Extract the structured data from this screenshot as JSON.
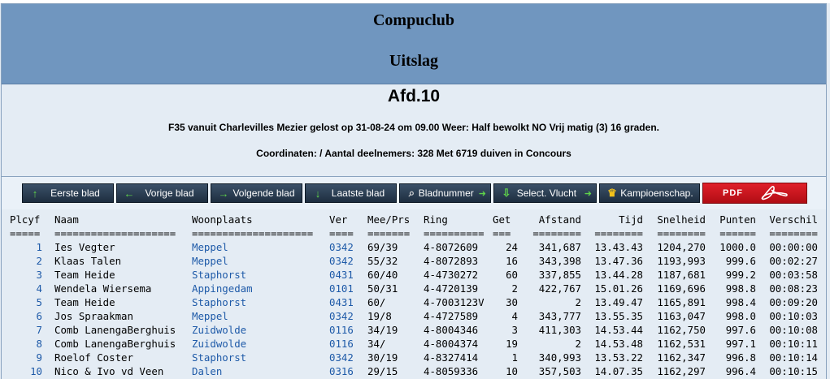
{
  "header": {
    "club": "Compuclub",
    "subtitle": "Uitslag"
  },
  "section": {
    "title": "Afd.10"
  },
  "flight_info": "F35 vanuit Charlevilles Mezier gelost op 31-08-24 om 09.00 Weer: Half bewolkt NO Vrij matig (3) 16 graden.",
  "coords_info": "Coordinaten: / Aantal deelnemers: 328 Met 6719 duiven in Concours",
  "nav": {
    "first": "Eerste blad",
    "prev": "Vorige blad",
    "next": "Volgende blad",
    "last": "Laatste blad",
    "page_number": "Bladnummer",
    "select_flight": "Select. Vlucht",
    "championship": "Kampioenschap.",
    "pdf": "PDF"
  },
  "colors": {
    "header_bg": "#7096bf",
    "page_bg": "#e4ecf4",
    "button_bg": "#2c3e52",
    "link_blue": "#1e5aa8",
    "pdf_red": "#d41820"
  },
  "icons": {
    "first": "up-arrow-icon",
    "prev": "left-arrow-icon",
    "next": "right-arrow-icon",
    "last": "down-arrow-icon",
    "page_number": "search-icon",
    "select_flight": "download-icon",
    "championship": "crown-icon",
    "pdf": "acrobat-icon"
  },
  "table": {
    "headers": [
      "Plcyf",
      "Naam",
      "Woonplaats",
      "Ver",
      "Mee/Prs",
      "Ring",
      "Get",
      "Afstand",
      "Tijd",
      "Snelheid",
      "Punten",
      "Verschil"
    ],
    "underlines": [
      "=====",
      "====================",
      "====================",
      "====",
      "=======",
      "==========",
      "===",
      "========",
      "========",
      "========",
      "======",
      "========"
    ],
    "rows": [
      [
        "1",
        "Ies Vegter",
        "Meppel",
        "0342",
        "69/39",
        "4-8072609",
        "24",
        "341,687",
        "13.43.43",
        "1204,270",
        "1000.0",
        "00:00:00"
      ],
      [
        "2",
        "Klaas Talen",
        "Meppel",
        "0342",
        "55/32",
        "4-8072893",
        "16",
        "343,398",
        "13.47.36",
        "1193,993",
        "999.6",
        "00:02:27"
      ],
      [
        "3",
        "Team Heide",
        "Staphorst",
        "0431",
        "60/40",
        "4-4730272",
        "60",
        "337,855",
        "13.44.28",
        "1187,681",
        "999.2",
        "00:03:58"
      ],
      [
        "4",
        "Wendela Wiersema",
        "Appingedam",
        "0101",
        "50/31",
        "4-4720139",
        "2",
        "422,767",
        "15.01.26",
        "1169,696",
        "998.8",
        "00:08:23"
      ],
      [
        "5",
        "Team Heide",
        "Staphorst",
        "0431",
        "60/",
        "4-7003123V",
        "30",
        "2",
        "13.49.47",
        "1165,891",
        "998.4",
        "00:09:20"
      ],
      [
        "6",
        "Jos Spraakman",
        "Meppel",
        "0342",
        "19/8",
        "4-4727589",
        "4",
        "343,777",
        "13.55.35",
        "1163,047",
        "998.0",
        "00:10:03"
      ],
      [
        "7",
        "Comb LanengaBerghuis",
        "Zuidwolde",
        "0116",
        "34/19",
        "4-8004346",
        "3",
        "411,303",
        "14.53.44",
        "1162,750",
        "997.6",
        "00:10:08"
      ],
      [
        "8",
        "Comb LanengaBerghuis",
        "Zuidwolde",
        "0116",
        "34/",
        "4-8004374",
        "19",
        "2",
        "14.53.48",
        "1162,531",
        "997.1",
        "00:10:11"
      ],
      [
        "9",
        "Roelof Coster",
        "Staphorst",
        "0342",
        "30/19",
        "4-8327414",
        "1",
        "340,993",
        "13.53.22",
        "1162,347",
        "996.8",
        "00:10:14"
      ],
      [
        "10",
        "Nico & Ivo vd Veen",
        "Dalen",
        "0316",
        "29/15",
        "4-8059336",
        "10",
        "357,503",
        "14.07.35",
        "1162,297",
        "996.4",
        "00:10:15"
      ]
    ]
  }
}
